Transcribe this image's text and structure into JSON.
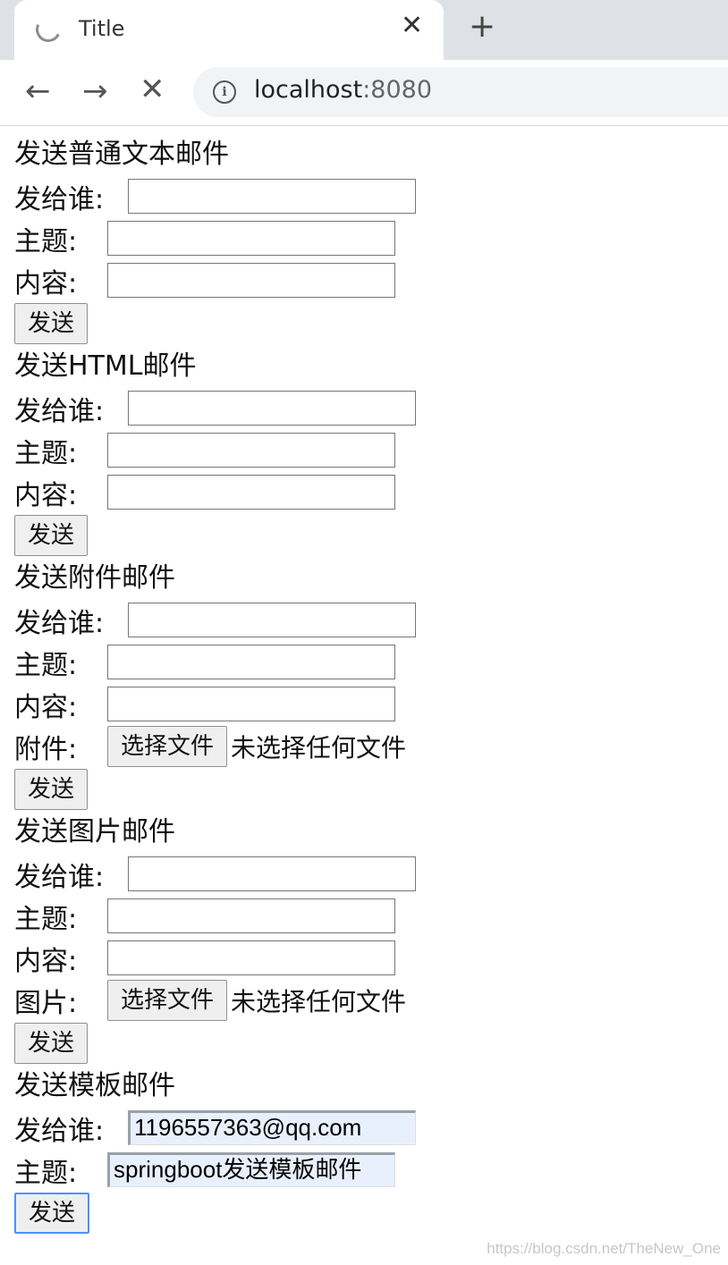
{
  "browser": {
    "tab_title": "Title",
    "url_host": "localhost",
    "url_port": ":8080"
  },
  "sections": {
    "plain": {
      "title": "发送普通文本邮件",
      "to_label": "发给谁:",
      "subject_label": "主题:",
      "content_label": "内容:",
      "submit": "发送"
    },
    "html": {
      "title": "发送HTML邮件",
      "to_label": "发给谁:",
      "subject_label": "主题:",
      "content_label": "内容:",
      "submit": "发送"
    },
    "attachment": {
      "title": "发送附件邮件",
      "to_label": "发给谁:",
      "subject_label": "主题:",
      "content_label": "内容:",
      "file_label": "附件:",
      "file_button": "选择文件",
      "file_status": "未选择任何文件",
      "submit": "发送"
    },
    "image": {
      "title": "发送图片邮件",
      "to_label": "发给谁:",
      "subject_label": "主题:",
      "content_label": "内容:",
      "file_label": "图片:",
      "file_button": "选择文件",
      "file_status": "未选择任何文件",
      "submit": "发送"
    },
    "template": {
      "title": "发送模板邮件",
      "to_label": "发给谁:",
      "to_value": "1196557363@qq.com",
      "subject_label": "主题:",
      "subject_value": "springboot发送模板邮件",
      "submit": "发送"
    }
  },
  "watermark": "https://blog.csdn.net/TheNew_One"
}
